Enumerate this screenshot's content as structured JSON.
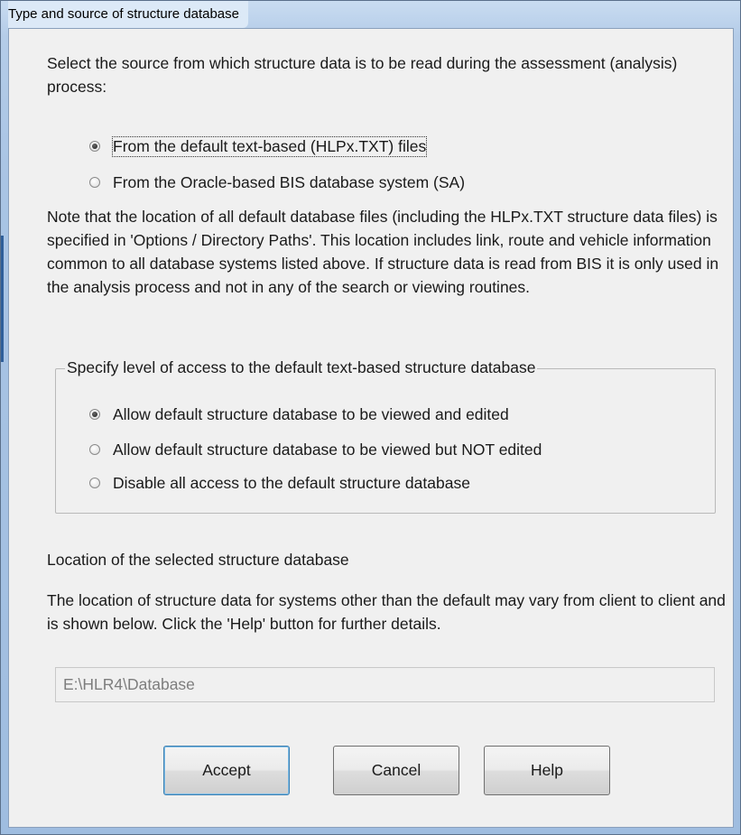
{
  "window": {
    "title": "Type and source of structure database"
  },
  "source": {
    "intro": "Select the source from which structure data is to be read during the assessment (analysis) process:",
    "options": [
      {
        "label": "From the default text-based (HLPx.TXT) files",
        "checked": true
      },
      {
        "label": "From the Oracle-based BIS database system  (SA)",
        "checked": false
      }
    ]
  },
  "note": {
    "text": "Note that the location of all default database files (including the HLPx.TXT structure data files) is specified in  'Options / Directory Paths'.  This location includes link, route and vehicle information common to all database systems listed above.  If structure data is read from BIS it is only used in the analysis process and not in any of the search or viewing routines."
  },
  "access": {
    "legend": "Specify level of access to the default text-based structure database",
    "options": [
      {
        "label": "Allow default structure database to be viewed and edited",
        "checked": true
      },
      {
        "label": "Allow default structure database to be viewed but NOT edited",
        "checked": false
      },
      {
        "label": "Disable all access to the default structure database",
        "checked": false
      }
    ]
  },
  "location": {
    "heading": "Location of the selected structure database",
    "description": "The location of structure data for systems other than the default may vary from client to client and is shown below.  Click the 'Help' button for further details.",
    "path": "E:\\HLR4\\Database"
  },
  "buttons": {
    "accept": "Accept",
    "cancel": "Cancel",
    "help": "Help"
  },
  "colors": {
    "frame": "#a9c4e4",
    "client": "#f0f0f0",
    "default_button_border": "#3c7fb1"
  }
}
